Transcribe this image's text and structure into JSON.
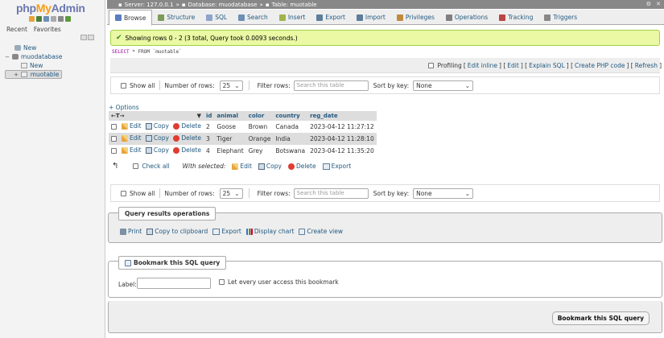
{
  "nav": {
    "logo_php": "php",
    "logo_my": "My",
    "logo_admin": "Admin",
    "tab_recent": "Recent",
    "tab_favorites": "Favorites",
    "tree": [
      {
        "label": "New",
        "level": 0
      },
      {
        "label": "muodatabase",
        "level": 0
      },
      {
        "label": "New",
        "level": 1
      },
      {
        "label": "muotable",
        "level": 1
      }
    ]
  },
  "breadcrumb": {
    "server": "Server: 127.0.0.1",
    "database": "Database: muodatabase",
    "table": "Table: muotable"
  },
  "tabs": [
    {
      "label": "Browse",
      "icon": "browse-icon",
      "color": "#5a7dbf"
    },
    {
      "label": "Structure",
      "icon": "structure-icon",
      "color": "#7c9b5a"
    },
    {
      "label": "SQL",
      "icon": "sql-icon",
      "color": "#8da5c9"
    },
    {
      "label": "Search",
      "icon": "search-icon",
      "color": "#6b8fb5"
    },
    {
      "label": "Insert",
      "icon": "insert-icon",
      "color": "#9fb44a"
    },
    {
      "label": "Export",
      "icon": "export-icon",
      "color": "#5d7d9a"
    },
    {
      "label": "Import",
      "icon": "import-icon",
      "color": "#5d7d9a"
    },
    {
      "label": "Privileges",
      "icon": "privileges-icon",
      "color": "#c08a3e"
    },
    {
      "label": "Operations",
      "icon": "operations-icon",
      "color": "#7f7f7f"
    },
    {
      "label": "Tracking",
      "icon": "tracking-icon",
      "color": "#b44"
    },
    {
      "label": "Triggers",
      "icon": "triggers-icon",
      "color": "#888"
    }
  ],
  "success_message": "Showing rows 0 - 2 (3 total, Query took 0.0093 seconds.)",
  "sql": {
    "keyword_select": "SELECT",
    "rest": " * FROM `muotable`"
  },
  "profiling": {
    "label": "Profiling",
    "edit_inline": "Edit inline",
    "edit": "Edit",
    "explain": "Explain SQL",
    "php_code": "Create PHP code",
    "refresh": "Refresh"
  },
  "navbar": {
    "show_all": "Show all",
    "num_rows_label": "Number of rows:",
    "num_rows_value": "25",
    "filter_label": "Filter rows:",
    "filter_placeholder": "Search this table",
    "sort_label": "Sort by key:",
    "sort_value": "None"
  },
  "options_label": "+ Options",
  "table": {
    "columns": [
      "id",
      "animal",
      "color",
      "country",
      "reg_date"
    ],
    "rows": [
      [
        "2",
        "Goose",
        "Brown",
        "Canada",
        "2023-04-12 11:27:12"
      ],
      [
        "3",
        "Tiger",
        "Orange",
        "India",
        "2023-04-12 11:28:10"
      ],
      [
        "4",
        "Elephant",
        "Grey",
        "Botswana",
        "2023-04-12 11:35:20"
      ]
    ],
    "edit_label": "Edit",
    "copy_label": "Copy",
    "delete_label": "Delete"
  },
  "with_selected": {
    "check_all": "Check all",
    "label": "With selected:",
    "edit": "Edit",
    "copy": "Copy",
    "delete": "Delete",
    "export": "Export"
  },
  "query_ops": {
    "legend": "Query results operations",
    "print": "Print",
    "copy_clipboard": "Copy to clipboard",
    "export": "Export",
    "display_chart": "Display chart",
    "create_view": "Create view"
  },
  "bookmark": {
    "legend": "Bookmark this SQL query",
    "label_field": "Label:",
    "every_user": "Let every user access this bookmark",
    "button": "Bookmark this SQL query"
  }
}
